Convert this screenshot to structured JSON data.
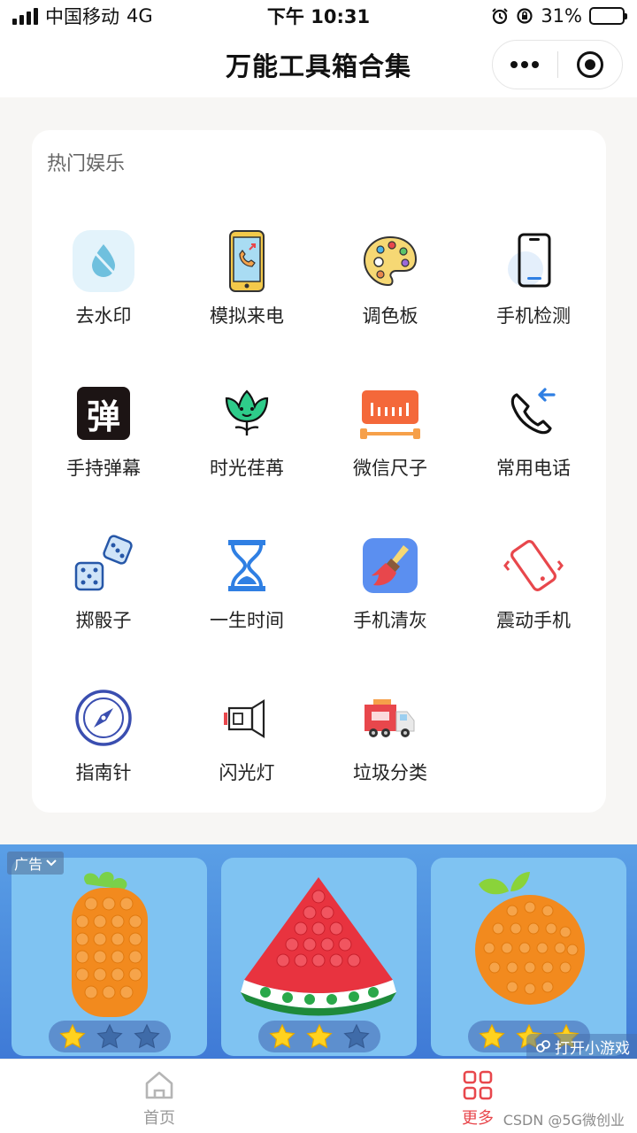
{
  "status_bar": {
    "carrier": "中国移动",
    "network": "4G",
    "time": "下午 10:31",
    "battery_percent": "31%",
    "battery_level": 0.31
  },
  "navbar": {
    "title": "万能工具箱合集"
  },
  "section": {
    "title": "热门娱乐",
    "tools": [
      {
        "label": "去水印",
        "icon": "water-drop-icon"
      },
      {
        "label": "模拟来电",
        "icon": "phone-call-icon"
      },
      {
        "label": "调色板",
        "icon": "palette-icon"
      },
      {
        "label": "手机检测",
        "icon": "phone-check-icon"
      },
      {
        "label": "手持弹幕",
        "icon": "danmaku-icon",
        "glyph": "弹"
      },
      {
        "label": "时光荏苒",
        "icon": "sprout-icon"
      },
      {
        "label": "微信尺子",
        "icon": "ruler-icon"
      },
      {
        "label": "常用电话",
        "icon": "incoming-call-icon"
      },
      {
        "label": "掷骰子",
        "icon": "dice-icon"
      },
      {
        "label": "一生时间",
        "icon": "hourglass-icon"
      },
      {
        "label": "手机清灰",
        "icon": "broom-icon"
      },
      {
        "label": "震动手机",
        "icon": "vibrate-icon"
      },
      {
        "label": "指南针",
        "icon": "compass-icon"
      },
      {
        "label": "闪光灯",
        "icon": "flashlight-icon"
      },
      {
        "label": "垃圾分类",
        "icon": "garbage-truck-icon"
      }
    ]
  },
  "ad": {
    "tag": "广告",
    "open_game": "打开小游戏",
    "games": [
      {
        "name": "carrot-popit",
        "stars": 1
      },
      {
        "name": "watermelon-popit",
        "stars": 2
      },
      {
        "name": "orange-popit",
        "stars": 3
      }
    ]
  },
  "tabbar": {
    "home": "首页",
    "more": "更多",
    "active_color": "#e8474c"
  },
  "watermark": "CSDN @5G微创业"
}
